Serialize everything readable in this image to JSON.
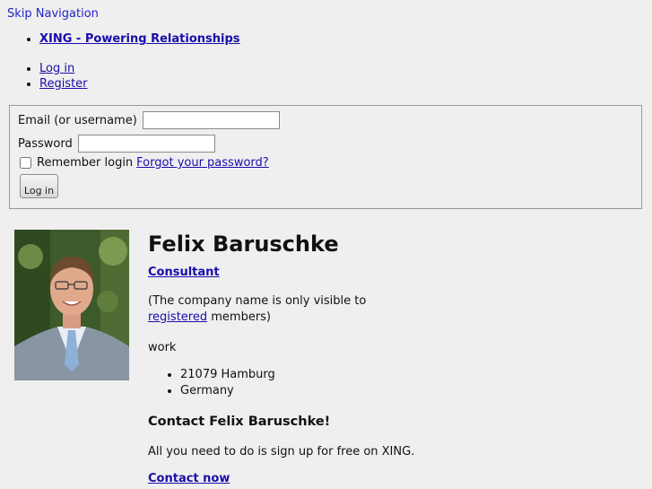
{
  "skip_nav": "Skip Navigation",
  "brand_link": "XING - Powering Relationships",
  "auth_links": {
    "login": "Log in",
    "register": "Register"
  },
  "login_form": {
    "email_label": "Email (or username)",
    "password_label": "Password",
    "remember_label": "Remember login",
    "forgot_link": "Forgot your password?",
    "submit_label": "Log in"
  },
  "profile": {
    "name": "Felix Baruschke",
    "position": "Consultant",
    "company_note_before": "(The company name is only visible to ",
    "company_note_link": "registered",
    "company_note_after": " members)",
    "work_heading": "work",
    "location": [
      "21079 Hamburg",
      "Germany"
    ]
  },
  "contact": {
    "heading": "Contact Felix Baruschke!",
    "text": "All you need to do is sign up for free on XING.",
    "link": "Contact now"
  }
}
